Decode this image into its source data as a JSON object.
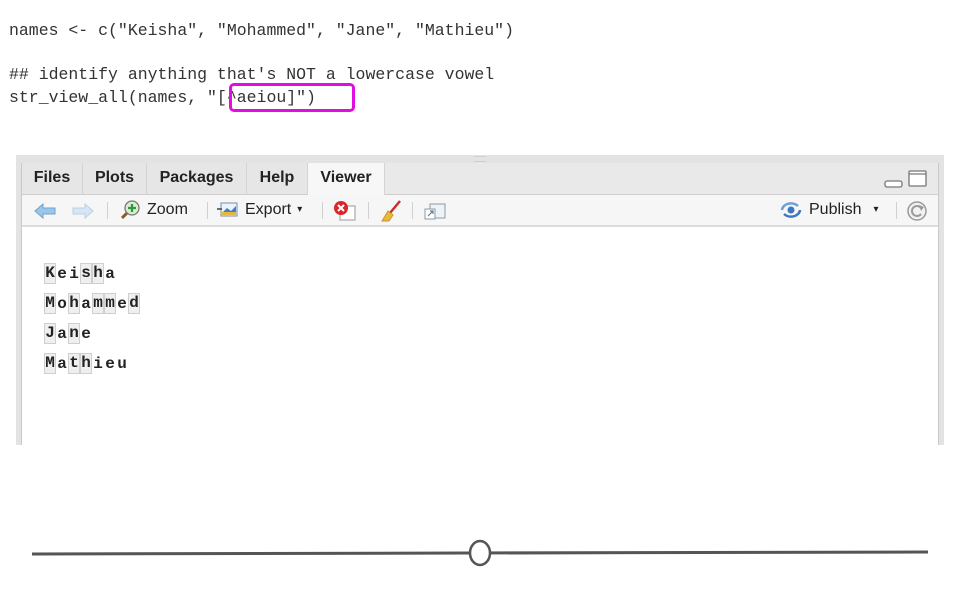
{
  "code": {
    "line1": "names <- c(\"Keisha\", \"Mohammed\", \"Jane\", \"Mathieu\")",
    "line2": "## identify anything that's NOT a lowercase vowel",
    "line3": "str_view_all(names, \"[^aeiou]\")",
    "highlighted_fragment": "\"[^aeiou]\"",
    "highlight_color": "#e00ee0"
  },
  "rstudio_pane": {
    "tabs": [
      {
        "label": "Files",
        "active": false
      },
      {
        "label": "Plots",
        "active": false
      },
      {
        "label": "Packages",
        "active": false
      },
      {
        "label": "Help",
        "active": false
      },
      {
        "label": "Viewer",
        "active": true
      }
    ],
    "toolbar": {
      "back_icon": "arrow-left-icon",
      "forward_icon": "arrow-right-icon",
      "zoom_label": "Zoom",
      "export_label": "Export",
      "clear_icon": "remove-viewer-icon",
      "broom_icon": "broom-icon",
      "popout_icon": "show-in-window-icon",
      "publish_label": "Publish",
      "refresh_icon": "refresh-icon"
    },
    "viewer_output": [
      {
        "text": "Keisha",
        "matched": [
          true,
          false,
          false,
          true,
          true,
          false
        ]
      },
      {
        "text": "Mohammed",
        "matched": [
          true,
          false,
          true,
          false,
          true,
          true,
          false,
          true
        ]
      },
      {
        "text": "Jane",
        "matched": [
          true,
          false,
          true,
          false
        ]
      },
      {
        "text": "Mathieu",
        "matched": [
          true,
          false,
          true,
          true,
          false,
          false,
          false
        ]
      }
    ]
  },
  "slider": {
    "value_fraction": 0.5
  }
}
